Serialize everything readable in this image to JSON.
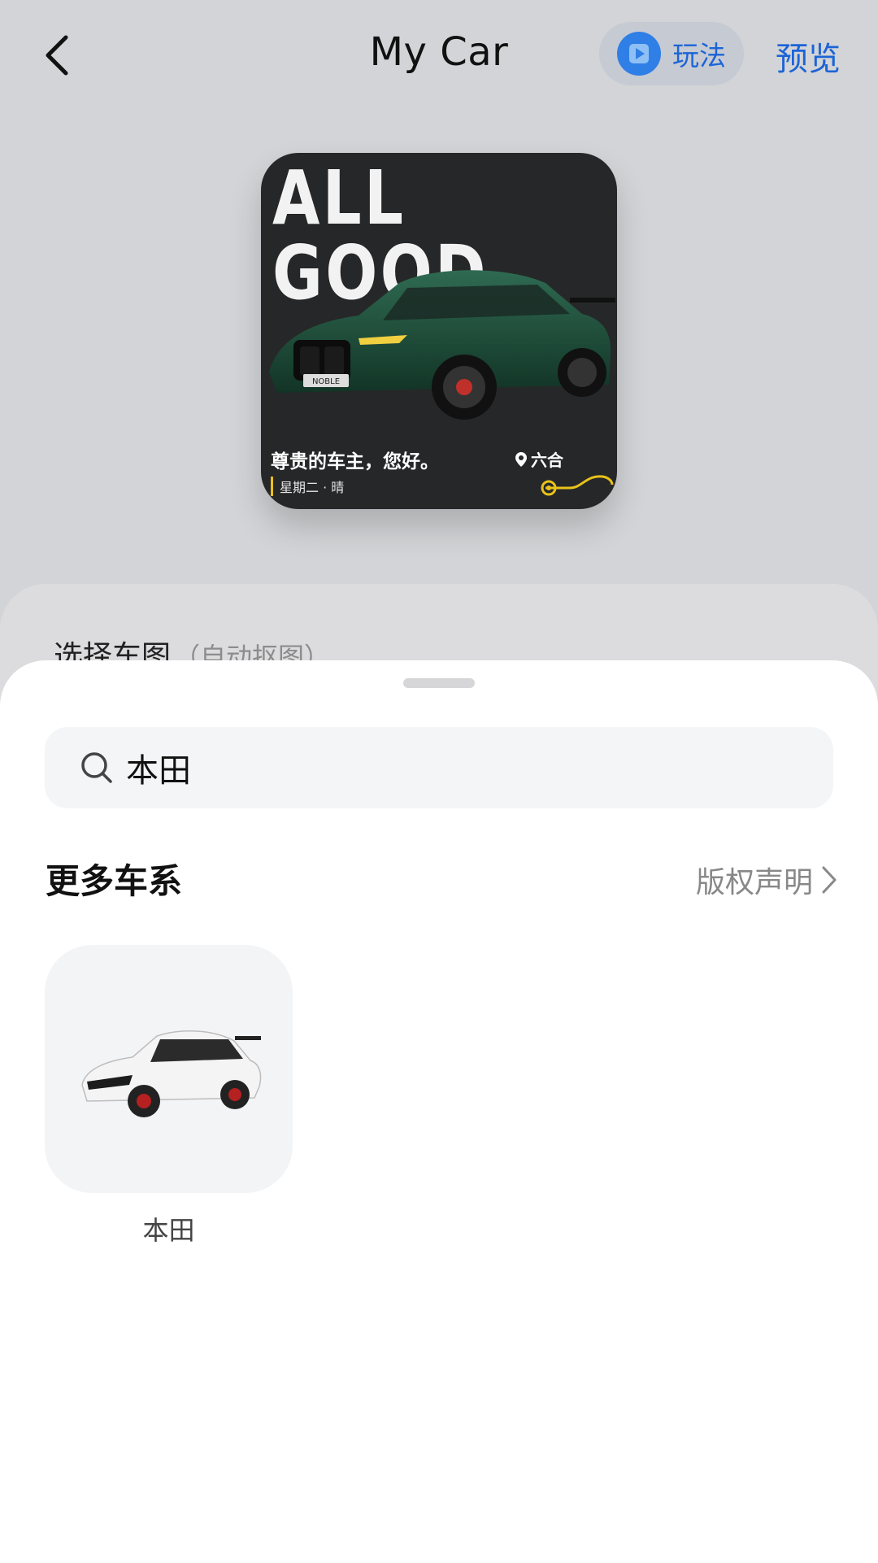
{
  "header": {
    "title": "My Car",
    "guide_label": "玩法",
    "preview_label": "预览"
  },
  "card": {
    "big_text_line1": "ALL",
    "big_text_line2": "GOOD",
    "plate": "NOBLE",
    "greeting": "尊贵的车主，您好。",
    "location": "六合",
    "date_weather": "星期二 · 晴"
  },
  "back_panel": {
    "title": "选择车图",
    "subtitle": "（自动抠图）"
  },
  "sheet": {
    "search_value": "本田",
    "section_title": "更多车系",
    "copyright_label": "版权声明",
    "series": [
      {
        "label": "本田"
      }
    ]
  },
  "colors": {
    "accent": "#1c64d6",
    "background": "#d3d4d7",
    "card_bg": "#262728",
    "car_green": "#1f4a3a"
  },
  "icons": [
    "back-arrow-icon",
    "play-icon",
    "location-pin-icon",
    "search-icon",
    "chevron-right-icon"
  ]
}
